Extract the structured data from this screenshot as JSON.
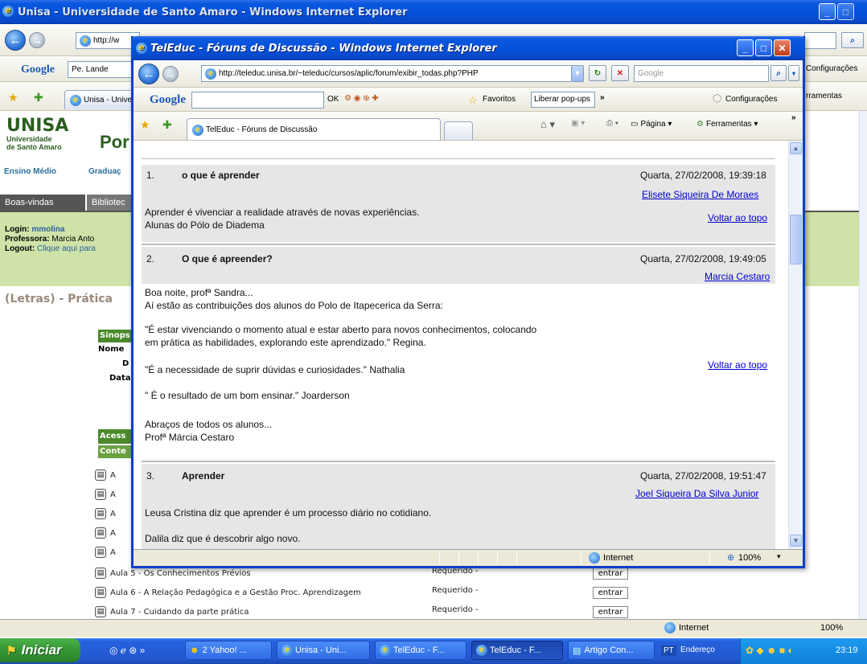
{
  "outer_window": {
    "title": "Unisa - Universidade de Santo Amaro - Windows Internet Explorer",
    "address": "http://w",
    "google_label": "Google",
    "google_field": "Pe. Lande",
    "config_label": "Configurações",
    "tab_label": "Unisa - Unive",
    "tools_label": "rramentas",
    "logo_title": "UNISA",
    "logo_sub1": "Universidade",
    "logo_sub2": "de Santo Amaro",
    "logo_portal": "Por",
    "nav_links": [
      "Ensino Médio",
      "Graduaç"
    ],
    "tabs": [
      "Boas-vindas",
      "Bibliotec"
    ],
    "login_label": "Login:",
    "login_value": "mmolina",
    "prof_label": "Professora:",
    "prof_value": "Marcia Anto",
    "logout_label": "Logout:",
    "logout_value": "Clique aqui para",
    "course_title": "(Letras) - Prática",
    "side_labels": [
      "Sinops",
      "Nome",
      "D",
      "Data"
    ],
    "access_labels": [
      "Acess",
      "Conte"
    ],
    "lesson_stub": "A",
    "lessons": [
      {
        "title": "Aula 5 - Os Conhecimentos Prévios",
        "req": "Requerido -",
        "btn": "entrar"
      },
      {
        "title": "Aula 6 - A Relação Pedagógica e a Gestão Proc. Aprendizagem",
        "req": "Requerido -",
        "btn": "entrar"
      },
      {
        "title": "Aula 7 - Cuidando da parte prática",
        "req": "Requerido -",
        "btn": "entrar"
      }
    ],
    "status_zone": "Internet",
    "status_zoom": "100%"
  },
  "popup": {
    "title": "TelEduc - Fóruns de Discussão - Windows Internet Explorer",
    "address": "http://teleduc.unisa.br/~teleduc/cursos/aplic/forum/exibir_todas.php?PHP",
    "search_placeholder": "Google",
    "google_label": "Google",
    "ok_label": "OK",
    "favorites_label": "Favoritos",
    "popups_label": "Liberar pop-ups",
    "config_label": "Configurações",
    "tab_label": "TelEduc - Fóruns de Discussão",
    "page_label": "Página",
    "tools_label": "Ferramentas",
    "status_zone": "Internet",
    "status_zoom": "100%",
    "back_to_top": "Voltar ao topo",
    "posts": [
      {
        "number": "1.",
        "title": "o que é aprender",
        "date": "Quarta, 27/02/2008, 19:39:18",
        "author": "Elisete Siqueira De Moraes",
        "lines": [
          "Aprender é vivenciar a realidade através de novas experiências.",
          "Alunas do Pólo de Diadema"
        ]
      },
      {
        "number": "2.",
        "title": "O que é apreender?",
        "date": "Quarta, 27/02/2008, 19:49:05",
        "author": "Marcia Cestaro",
        "lines": [
          "Boa noite, profª Sandra...",
          "Aí estão as contribuições dos alunos do Polo de Itapecerica da Serra:",
          "\"É estar vivenciando o momento atual e estar aberto para novos conhecimentos, colocando",
          "em prática as habilidades, explorando este aprendizado.\" Regina.",
          "\"É a necessidade de suprir dúvidas e curiosidades.\" Nathalia",
          "\" É o resultado de um bom ensinar.\" Joarderson",
          "Abraços de todos os alunos...",
          "Profª Márcia Cestaro"
        ]
      },
      {
        "number": "3.",
        "title": "Aprender",
        "date": "Quarta, 27/02/2008, 19:51:47",
        "author": "Joel Siqueira Da Silva Junior",
        "lines": [
          "Leusa Cristina diz que aprender é um processo diário no cotidiano.",
          "Dalila diz que é descobrir algo novo."
        ]
      }
    ]
  },
  "taskbar": {
    "start": "Iniciar",
    "tasks": [
      "2 Yahoo! ...",
      "Unisa - Uni...",
      "TelEduc - F...",
      "TelEduc - F...",
      "Artigo Con..."
    ],
    "lang": "PT",
    "address_label": "Endereço",
    "clock": "23:19"
  },
  "colors": {
    "xp_blue": "#0450d8",
    "unisa_green": "#2b5e1e",
    "link": "#0000cc",
    "post_header": "#e6e6e6"
  }
}
